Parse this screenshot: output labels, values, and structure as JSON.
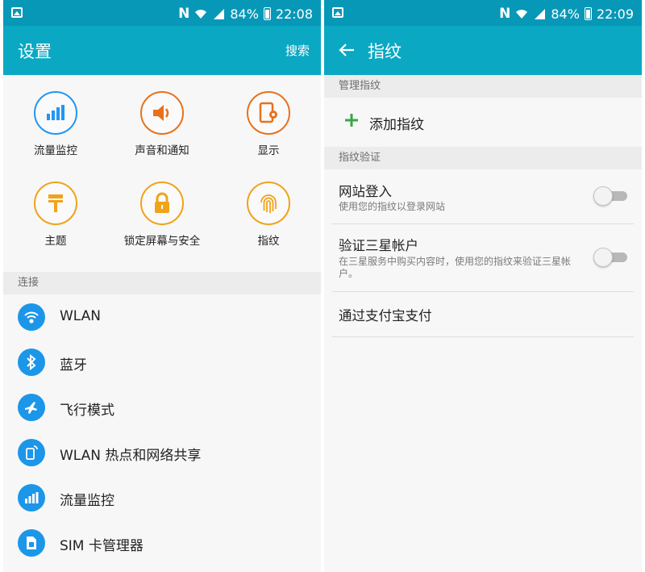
{
  "left": {
    "status": {
      "battery": "84%",
      "time": "22:08",
      "n_label": "N"
    },
    "appbar": {
      "title": "设置",
      "action": "搜索"
    },
    "grid": [
      {
        "label": "流量监控",
        "icon": "data-usage-icon",
        "color": "#2196f3"
      },
      {
        "label": "声音和通知",
        "icon": "sound-icon",
        "color": "#e8711c"
      },
      {
        "label": "显示",
        "icon": "display-icon",
        "color": "#e8711c"
      },
      {
        "label": "主题",
        "icon": "theme-brush-icon",
        "color": "#f0a31b"
      },
      {
        "label": "锁定屏幕与安全",
        "icon": "lock-icon",
        "color": "#f0a31b"
      },
      {
        "label": "指纹",
        "icon": "fingerprint-icon",
        "color": "#f0a31b"
      }
    ],
    "section": "连接",
    "list": [
      {
        "label": "WLAN",
        "icon": "wifi-icon"
      },
      {
        "label": "蓝牙",
        "icon": "bluetooth-icon"
      },
      {
        "label": "飞行模式",
        "icon": "airplane-icon"
      },
      {
        "label": "WLAN 热点和网络共享",
        "icon": "hotspot-icon"
      },
      {
        "label": "流量监控",
        "icon": "data-usage-icon"
      },
      {
        "label": "SIM 卡管理器",
        "icon": "sim-card-icon"
      }
    ]
  },
  "right": {
    "status": {
      "battery": "84%",
      "time": "22:09",
      "n_label": "N"
    },
    "appbar": {
      "title": "指纹"
    },
    "section1": "管理指纹",
    "add_fingerprint": "添加指纹",
    "section2": "指纹验证",
    "web_signin": {
      "title": "网站登入",
      "subtitle": "使用您的指纹以登录网站"
    },
    "samsung_account": {
      "title": "验证三星帐户",
      "subtitle": "在三星服务中购买内容时，使用您的指纹来验证三星帐户。"
    },
    "alipay": "通过支付宝支付",
    "accent": "#0ba8c3",
    "plus_color": "#3aa64a"
  }
}
